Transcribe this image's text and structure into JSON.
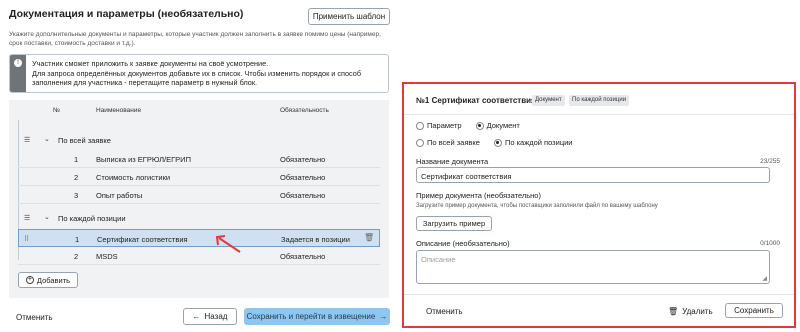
{
  "header": {
    "title": "Документация и параметры (необязательно)",
    "apply_template": "Применить шаблон",
    "description": "Укажите дополнительные документы и параметры, которые участник должен заполнить в заявке помимо цены (например, срок поставки, стоимость доставки и т.д.)."
  },
  "notice": {
    "icon": "info-icon",
    "line1": "Участник сможет приложить к заявке документы на своё усмотрение.",
    "line2": "Для запроса определённых документов добавьте их в список. Чтобы изменить порядок и способ заполнения для участника - перетащите параметр в нужный блок."
  },
  "table": {
    "columns": {
      "num": "№",
      "name": "Наименование",
      "required": "Обязательность"
    },
    "groups": [
      {
        "label": "По всей заявке",
        "rows": [
          {
            "num": "1",
            "name": "Выписка из ЕГРЮЛ/ЕГРИП",
            "required": "Обязательно"
          },
          {
            "num": "2",
            "name": "Стоимость логистики",
            "required": "Обязательно"
          },
          {
            "num": "3",
            "name": "Опыт работы",
            "required": "Обязательно"
          }
        ]
      },
      {
        "label": "По каждой позиции",
        "rows": [
          {
            "num": "1",
            "name": "Сертификат соответствия",
            "required": "Задается в позиции"
          },
          {
            "num": "2",
            "name": "MSDS",
            "required": "Обязательно"
          }
        ]
      }
    ],
    "add_button": "Добавить"
  },
  "footer": {
    "cancel": "Отменить",
    "back": "Назад",
    "save_go": "Сохранить и перейти в извещение"
  },
  "panel": {
    "title": "№1 Сертификат соответствия",
    "badge_doc": "Документ",
    "badge_pos": "По каждой позиции",
    "type_options": [
      "Параметр",
      "Документ"
    ],
    "type_selected": 1,
    "scope_options": [
      "По всей заявке",
      "По каждой позиции"
    ],
    "scope_selected": 1,
    "name_label": "Название документа",
    "name_count": "23/255",
    "name_value": "Сертификат соответствия",
    "example_label": "Пример документа (необязательно)",
    "example_hint": "Загрузите пример документа, чтобы поставщики заполнили файл по вашему шаблону",
    "upload_button": "Загрузить пример",
    "desc_label": "Описание (необязательно)",
    "desc_count": "0/1000",
    "desc_placeholder": "Описание",
    "cancel": "Отменить",
    "delete": "Удалить",
    "save": "Сохранить"
  },
  "colors": {
    "highlight_border": "#e23a3a",
    "primary_button": "#8ec6ef",
    "selected_row": "#cfe0f2",
    "annotation_arrow": "#e23a3a"
  }
}
